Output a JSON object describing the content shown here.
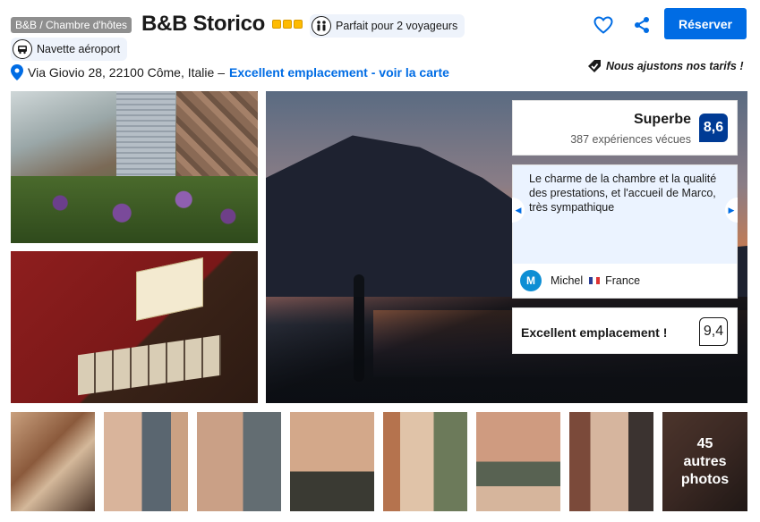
{
  "header": {
    "property_type": "B&B / Chambre d'hôtes",
    "hotel_name": "B&B Storico",
    "star_rating": 3,
    "travellers_label": "Parfait pour 2 voyageurs",
    "shuttle_label": "Navette aéroport",
    "favorite_icon": "heart-icon",
    "share_icon": "share-icon",
    "reserve_label": "Réserver",
    "accent_color": "#006ce4"
  },
  "address": {
    "text": "Via Giovio 28, 22100 Côme, Italie –",
    "link": "Excellent emplacement - voir la carte",
    "icon": "map-pin-icon"
  },
  "price_note": "Nous ajustons nos tarifs !",
  "rating": {
    "label": "Superbe",
    "reviews": "387 expériences vécues",
    "score": "8,6",
    "badge_color": "#003b95"
  },
  "review": {
    "text": "Le charme de la chambre et la qualité des prestations, et l'accueil de Marco, très sympathique",
    "avatar_initial": "M",
    "reviewer_name": "Michel",
    "reviewer_country": "France"
  },
  "location": {
    "label": "Excellent emplacement !",
    "score": "9,4"
  },
  "gallery": {
    "more_count": "45",
    "more_label_line1": "autres",
    "more_label_line2": "photos"
  }
}
